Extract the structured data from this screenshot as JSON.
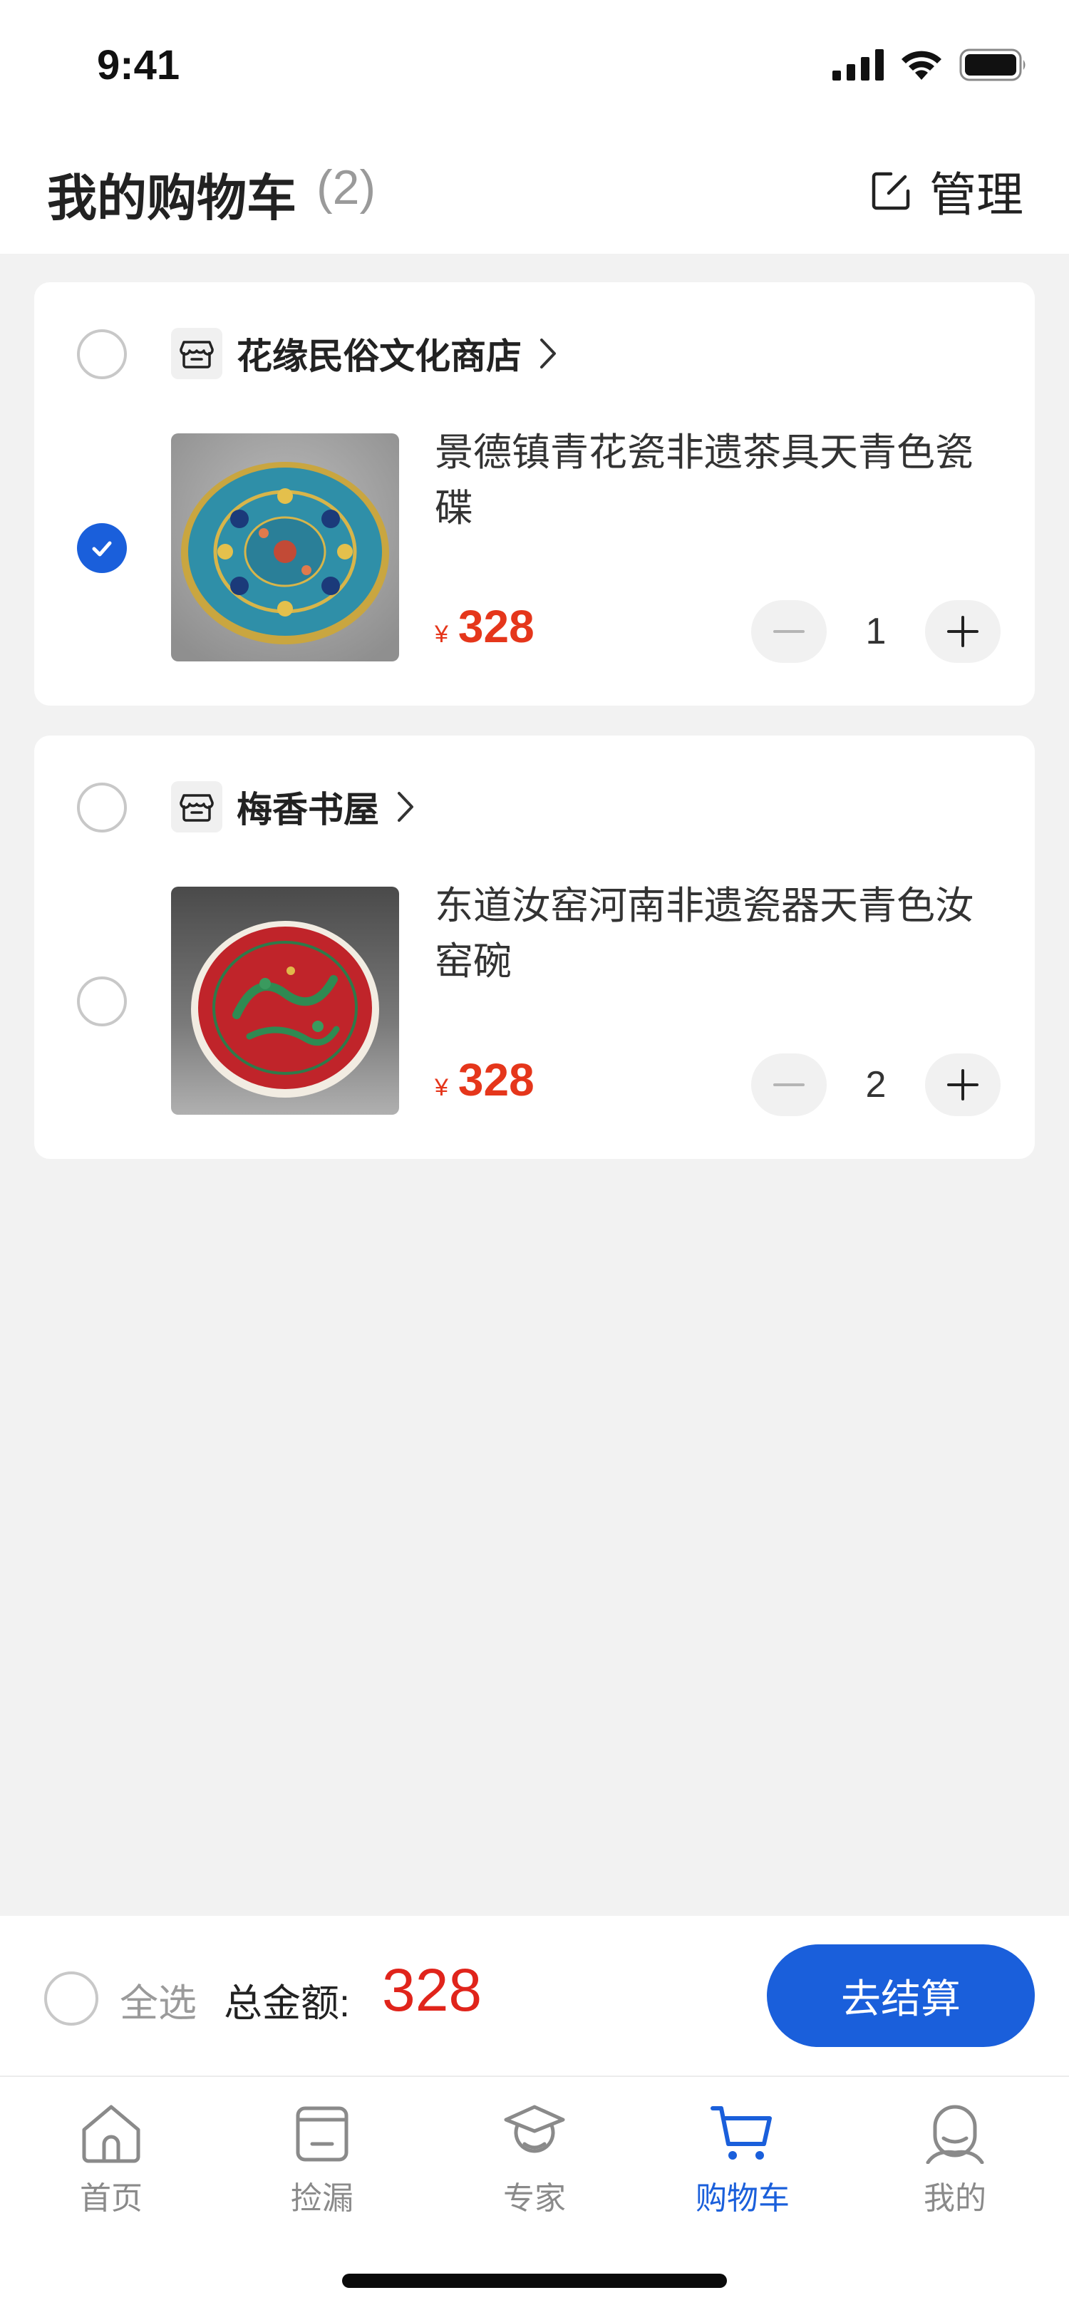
{
  "status_bar": {
    "time": "9:41"
  },
  "header": {
    "title": "我的购物车",
    "count": "(2)",
    "manage_label": "管理"
  },
  "cart": [
    {
      "shop_name": "花缘民俗文化商店",
      "shop_selected": false,
      "item_selected": true,
      "product_title": "景德镇青花瓷非遗茶具天青色瓷碟",
      "price_symbol": "¥",
      "price": "328",
      "quantity": "1"
    },
    {
      "shop_name": "梅香书屋",
      "shop_selected": false,
      "item_selected": false,
      "product_title": "东道汝窑河南非遗瓷器天青色汝窑碗",
      "price_symbol": "¥",
      "price": "328",
      "quantity": "2"
    }
  ],
  "summary": {
    "select_all_label": "全选",
    "total_label": "总金额:",
    "total_value": "328",
    "checkout_label": "去结算"
  },
  "tabs": [
    {
      "label": "首页",
      "icon": "home-icon",
      "active": false
    },
    {
      "label": "捡漏",
      "icon": "bargain-icon",
      "active": false
    },
    {
      "label": "专家",
      "icon": "expert-icon",
      "active": false
    },
    {
      "label": "购物车",
      "icon": "cart-icon",
      "active": true
    },
    {
      "label": "我的",
      "icon": "profile-icon",
      "active": false
    }
  ],
  "colors": {
    "accent": "#1a5fdb",
    "price": "#e5361b",
    "total": "#e0241b"
  }
}
